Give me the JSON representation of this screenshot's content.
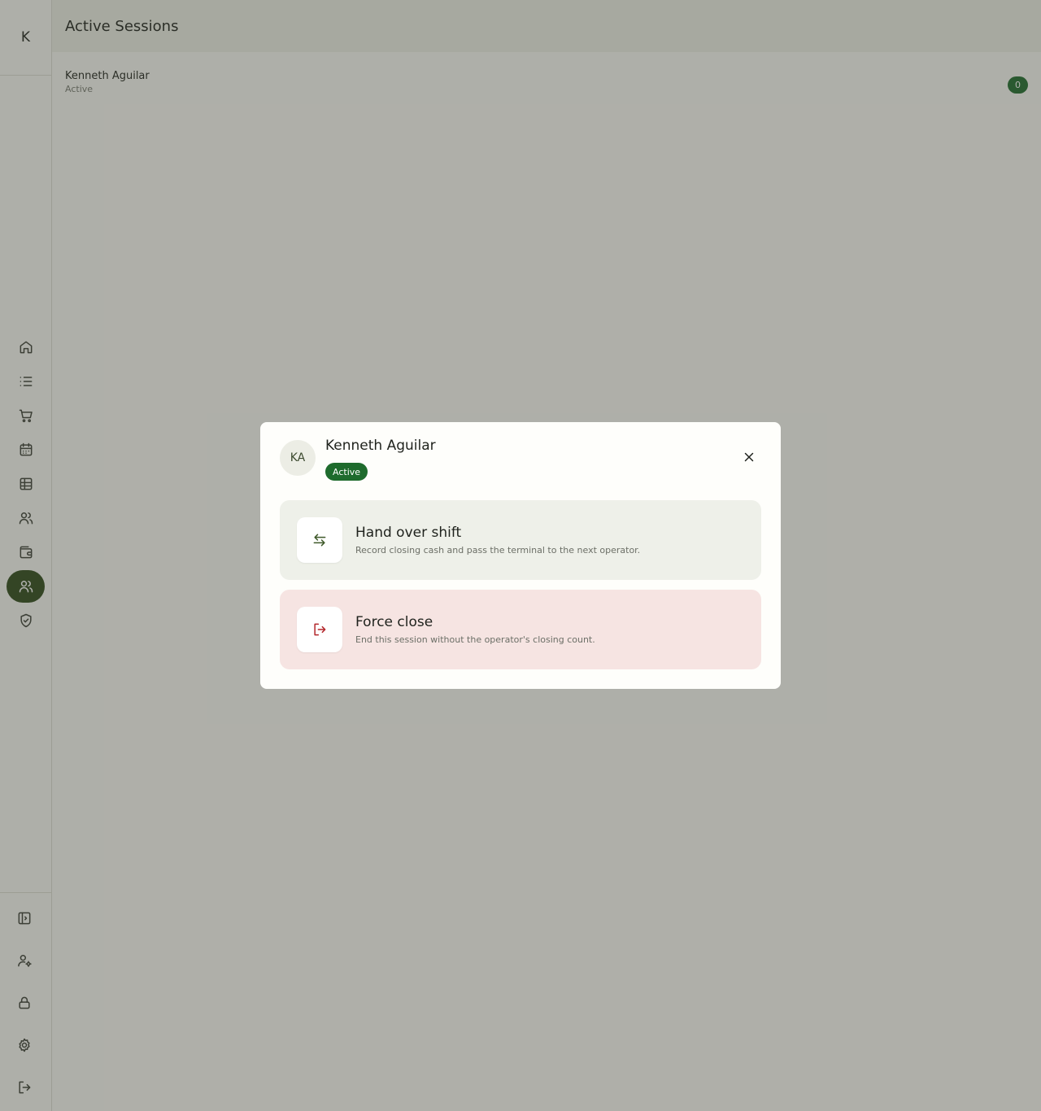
{
  "app": {
    "logo_letter": "K"
  },
  "header": {
    "title": "Active Sessions"
  },
  "sidebar": {
    "nav": [
      {
        "name": "home-icon",
        "active": false
      },
      {
        "name": "list-icon",
        "active": false
      },
      {
        "name": "cart-icon",
        "active": false
      },
      {
        "name": "calendar-icon",
        "active": false
      },
      {
        "name": "table-icon",
        "active": false
      },
      {
        "name": "users-icon",
        "active": false
      },
      {
        "name": "wallet-icon",
        "active": false
      },
      {
        "name": "sessions-users-icon",
        "active": true
      },
      {
        "name": "shield-check-icon",
        "active": false
      }
    ],
    "bottom": [
      "collapse-panel-icon",
      "user-settings-icon",
      "lock-icon",
      "gear-icon",
      "logout-icon"
    ]
  },
  "sessions": {
    "rows": [
      {
        "name": "Kenneth Aguilar",
        "status": "Active",
        "count": "0"
      }
    ]
  },
  "modal": {
    "initials": "KA",
    "name": "Kenneth Aguilar",
    "status": "Active",
    "actions": [
      {
        "title": "Hand over shift",
        "description": "Record closing cash and pass the terminal to the next operator.",
        "icon": "swap-arrows-icon"
      },
      {
        "title": "Force close",
        "description": "End this session without the operator's closing count.",
        "icon": "exit-icon"
      }
    ]
  },
  "colors": {
    "accent": "#2f4a1c",
    "status_green": "#1e6b2d",
    "danger": "#b3262b"
  }
}
